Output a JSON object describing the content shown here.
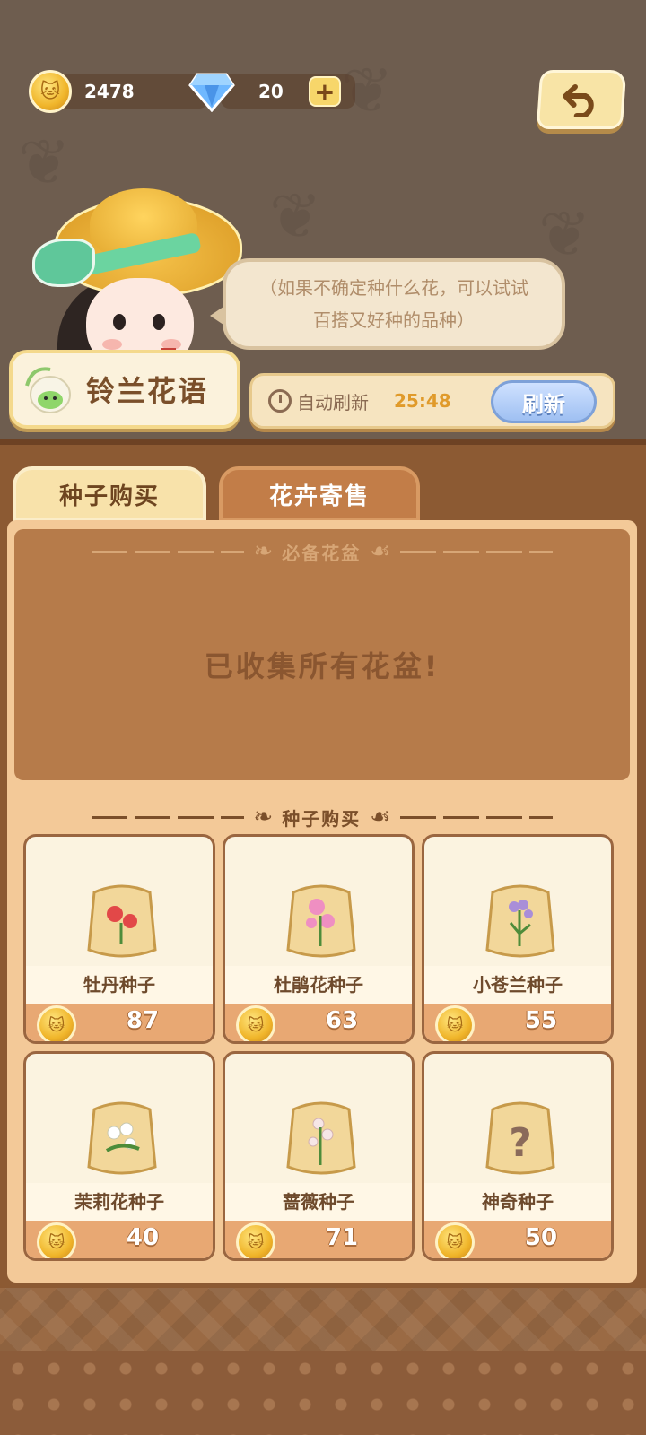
{
  "currency": {
    "coins": "2478",
    "gems": "20"
  },
  "dialog": {
    "text": "（如果不确定种什么花，可以试试百搭又好种的品种）"
  },
  "shop": {
    "name": "铃兰花语",
    "auto_refresh_label": "自动刷新",
    "timer": "25:48",
    "refresh_button": "刷新"
  },
  "tabs": [
    {
      "label": "种子购买",
      "active": true
    },
    {
      "label": "花卉寄售",
      "active": false
    }
  ],
  "pots_section": {
    "title": "必备花盆",
    "message": "已收集所有花盆!"
  },
  "seeds_section": {
    "title": "种子购买",
    "items": [
      {
        "name": "牡丹种子",
        "price": "87",
        "icon": "peony-seed-bag"
      },
      {
        "name": "杜鹃花种子",
        "price": "63",
        "icon": "azalea-seed-bag"
      },
      {
        "name": "小苍兰种子",
        "price": "55",
        "icon": "freesia-seed-bag"
      },
      {
        "name": "茉莉花种子",
        "price": "40",
        "icon": "jasmine-seed-bag"
      },
      {
        "name": "蔷薇种子",
        "price": "71",
        "icon": "rose-seed-bag"
      },
      {
        "name": "神奇种子",
        "price": "50",
        "icon": "mystery-seed-bag"
      }
    ]
  },
  "colors": {
    "board": "#8c5a33",
    "panel": "#f3c998",
    "accent_gold": "#f0b52a",
    "refresh_blue": "#9fc0f2"
  }
}
